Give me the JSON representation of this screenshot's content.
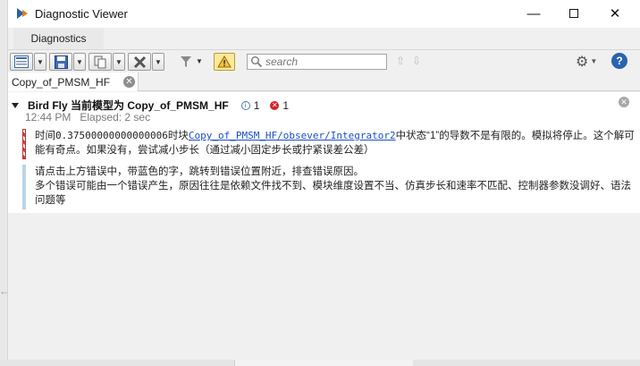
{
  "window": {
    "title": "Diagnostic Viewer",
    "controls": {
      "minimize": "—",
      "close": "✕"
    }
  },
  "ribbon": {
    "tab": "Diagnostics"
  },
  "toolbar": {
    "search_placeholder": "search",
    "up_arrow": "⇧",
    "down_arrow": "⇩",
    "help": "?"
  },
  "doc_tab": {
    "label": "Copy_of_PMSM_HF",
    "close": "✕"
  },
  "report": {
    "title": "Bird Fly 当前模型为 Copy_of_PMSM_HF",
    "info_count": "1",
    "error_count": "1",
    "time": "12:44 PM",
    "elapsed": "Elapsed: 2 sec",
    "close": "✕",
    "error_message": {
      "prefix": "时间",
      "time_value": "0.37500000000000006",
      "block_word": "时块",
      "block_link": "Copy_of_PMSM_HF/obsever/Integrator2",
      "suffix": "中状态“1”的导数不是有限的。模拟将停止。这个解可能有奇点。如果没有，尝试减小步长（通过减小固定步长或拧紧误差公差）"
    },
    "info_message": {
      "line1": "请点击上方错误中，带蓝色的字，跳转到错误位置附近，排查错误原因。",
      "line2": "多个错误可能由一个错误产生，原因往往是依赖文件找不到、模块维度设置不当、仿真步长和速率不匹配、控制器参数没调好、语法问题等"
    }
  },
  "colors": {
    "link": "#1a4fc4",
    "error_stripe": "#d24040",
    "info_stripe": "#b9d3ea",
    "active_toolbar": "#ffe99a"
  }
}
